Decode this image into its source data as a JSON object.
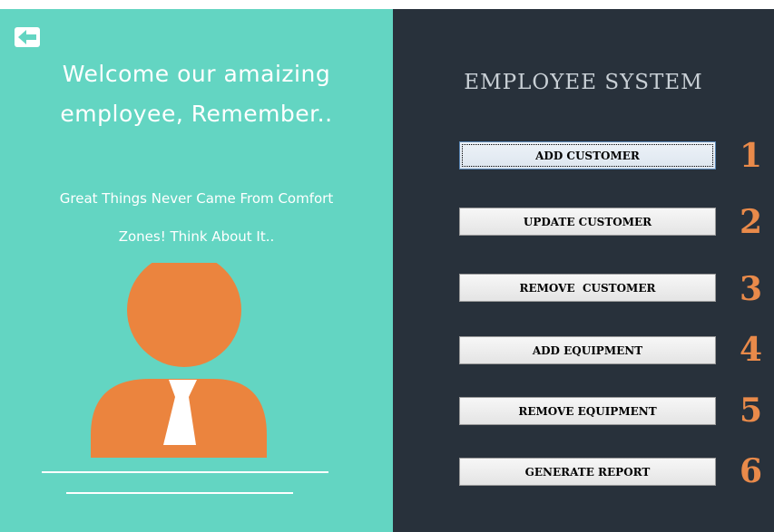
{
  "left": {
    "welcome_line1": "Welcome our amaizing",
    "welcome_line2": "employee, Remember..",
    "quote_line1": "Great Things Never Came From Comfort",
    "quote_line2": "Zones! Think About It.."
  },
  "right": {
    "title": "EMPLOYEE SYSTEM",
    "buttons": [
      {
        "label": "ADD CUSTOMER",
        "number": "1"
      },
      {
        "label": "UPDATE CUSTOMER",
        "number": "2"
      },
      {
        "label": "REMOVE  CUSTOMER",
        "number": "3"
      },
      {
        "label": "ADD EQUIPMENT",
        "number": "4"
      },
      {
        "label": "REMOVE EQUIPMENT",
        "number": "5"
      },
      {
        "label": "GENERATE REPORT",
        "number": "6"
      }
    ]
  },
  "icons": {
    "back": "back-arrow-icon",
    "avatar": "employee-avatar-icon"
  },
  "colors": {
    "left_bg": "#63d5c2",
    "right_bg": "#28313b",
    "accent_orange": "#e98a4a",
    "avatar_orange": "#eb843e"
  }
}
